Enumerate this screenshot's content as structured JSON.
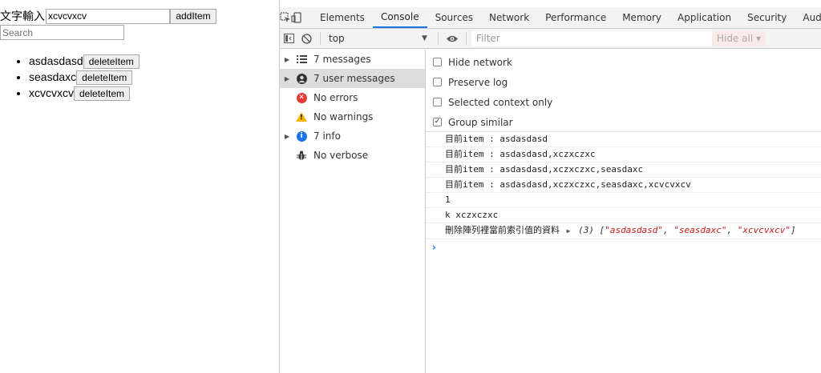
{
  "page": {
    "input_label": "文字輸入",
    "input_value": "xcvcvxcv",
    "add_button": "addItem",
    "search_placeholder": "Search",
    "items": [
      {
        "text": "asdasdasd",
        "button": "deleteItem"
      },
      {
        "text": "seasdaxc",
        "button": "deleteItem"
      },
      {
        "text": "xcvcvxcv",
        "button": "deleteItem"
      }
    ]
  },
  "devtools": {
    "tabs": [
      "Elements",
      "Console",
      "Sources",
      "Network",
      "Performance",
      "Memory",
      "Application",
      "Security",
      "Audi"
    ],
    "active_tab": "Console",
    "toolbar": {
      "context": "top",
      "filter_placeholder": "Filter",
      "levels": "Hide all"
    },
    "sidebar": [
      {
        "label": "7 messages",
        "icon": "list-icon",
        "expandable": true
      },
      {
        "label": "7 user messages",
        "icon": "user-icon",
        "expandable": true,
        "selected": true
      },
      {
        "label": "No errors",
        "icon": "error-icon",
        "expandable": false
      },
      {
        "label": "No warnings",
        "icon": "warning-icon",
        "expandable": false
      },
      {
        "label": "7 info",
        "icon": "info-icon",
        "expandable": true
      },
      {
        "label": "No verbose",
        "icon": "bug-icon",
        "expandable": false
      }
    ],
    "settings": [
      {
        "label": "Hide network",
        "checked": false
      },
      {
        "label": "Preserve log",
        "checked": false
      },
      {
        "label": "Selected context only",
        "checked": false
      },
      {
        "label": "Group similar",
        "checked": true
      }
    ],
    "messages": [
      "目前item : asdasdasd",
      "目前item : asdasdasd,xczxczxc",
      "目前item : asdasdasd,xczxczxc,seasdaxc",
      "目前item : asdasdasd,xczxczxc,seasdaxc,xcvcvxcv",
      "1",
      "k xczxczxc"
    ],
    "last_message": {
      "text": "刪除陣列裡當前索引值的資料",
      "array_prefix": "(3) [",
      "strings": [
        "\"asdasdasd\"",
        "\"seasdaxc\"",
        "\"xcvcvxcv\""
      ],
      "array_suffix": "]"
    },
    "prompt": "›",
    "colors": {
      "accent": "#1a73e8",
      "string": "#c41a16",
      "error": "#e53935",
      "warning": "#f4b400"
    }
  }
}
